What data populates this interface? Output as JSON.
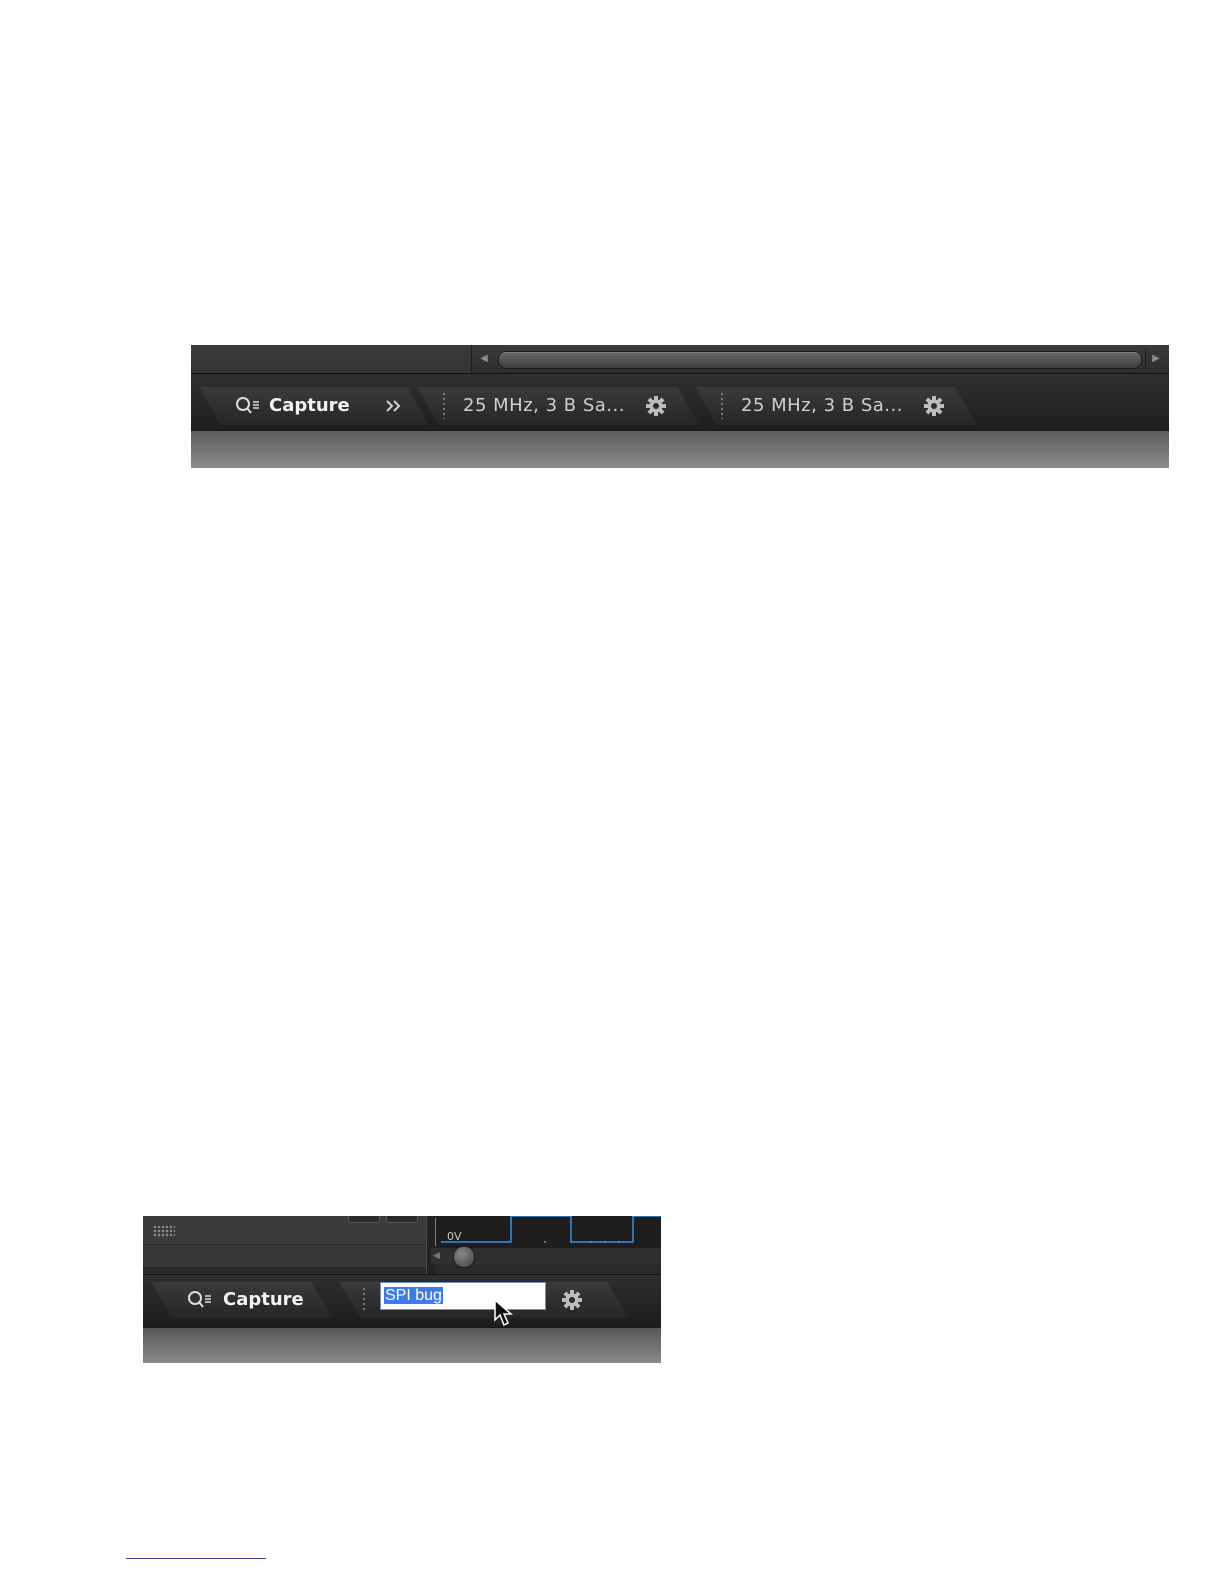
{
  "shot1": {
    "tabs": [
      {
        "label": "Capture",
        "icon": "search-list-icon"
      },
      {
        "label": "25 MHz, 3 B Sa...",
        "icon": "gear-icon"
      },
      {
        "label": "25 MHz, 3 B Sa...",
        "icon": "gear-icon"
      }
    ],
    "overflow_icon": "double-chevron-right-icon"
  },
  "shot2": {
    "capture_label": "Capture",
    "rename_value": "SPI bug",
    "waveform_label": "0V",
    "waveform_color": "#3a8fe0",
    "selection_color": "#3f7be8"
  }
}
